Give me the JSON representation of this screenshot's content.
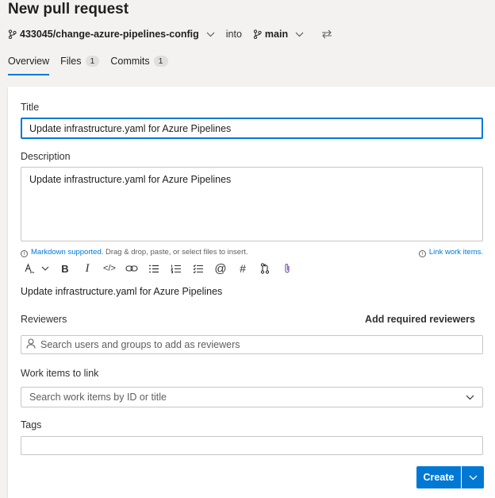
{
  "header": {
    "title": "New pull request",
    "source_branch": "433045/change-azure-pipelines-config",
    "into_label": "into",
    "target_branch": "main"
  },
  "tabs": [
    {
      "label": "Overview",
      "count": null
    },
    {
      "label": "Files",
      "count": "1"
    },
    {
      "label": "Commits",
      "count": "1"
    }
  ],
  "form": {
    "title_label": "Title",
    "title_value": "Update infrastructure.yaml for Azure Pipelines",
    "description_label": "Description",
    "description_value": "Update infrastructure.yaml for Azure Pipelines",
    "markdown_link": "Markdown supported.",
    "markdown_hint": " Drag & drop, paste, or select files to insert.",
    "link_work_items": "Link work items.",
    "preview_text": "Update infrastructure.yaml for Azure Pipelines",
    "reviewers_label": "Reviewers",
    "add_required_reviewers": "Add required reviewers",
    "reviewers_placeholder": "Search users and groups to add as reviewers",
    "work_items_label": "Work items to link",
    "work_items_placeholder": "Search work items by ID or title",
    "tags_label": "Tags",
    "create_label": "Create"
  },
  "toolbar_icons": [
    "format-icon",
    "chevron-down-icon",
    "bold-icon",
    "italic-icon",
    "code-icon",
    "link-icon",
    "bullet-list-icon",
    "numbered-list-icon",
    "task-list-icon",
    "mention-icon",
    "hashtag-icon",
    "pull-request-icon",
    "attachment-icon"
  ],
  "colors": {
    "accent": "#0078d4",
    "background": "#f3f2f1",
    "card": "#ffffff"
  }
}
